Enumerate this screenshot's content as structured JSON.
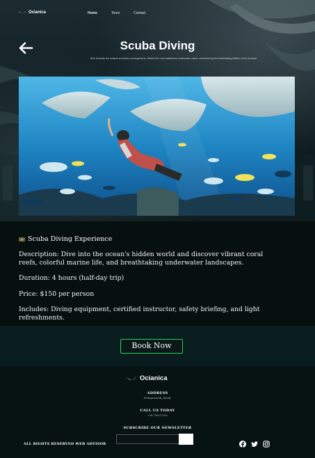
{
  "nav": {
    "brand": "Ocianica",
    "links": [
      "Home",
      "Tours",
      "Contact"
    ]
  },
  "hero": {
    "title": "Scuba Diving",
    "subtitle": "Dive beneath the surface to explore coral gardens, vibrant fish, and mysterious underwater caves, experiencing the breathtaking hidden world up close."
  },
  "details": {
    "heading": "Scuba Diving Experience",
    "description": "Description: Dive into the ocean's hidden world and discover vibrant coral reefs, colorful marine life, and breathtaking underwater landscapes.",
    "duration": "Duration: 4 hours (half-day trip)",
    "price": "Price: $150 per person",
    "includes": "Includes: Diving equipment, certified instructor, safety briefing, and light refreshments."
  },
  "cta": {
    "label": "Book Now"
  },
  "footer": {
    "brand": "Ocianica",
    "address_label": "ADDRESS",
    "address_value": "Bodugamavely, Bandy",
    "call_label": "CALL US TODAY",
    "call_value": "+94 756017385",
    "newsletter_label": "SUBSCRIBE OUR NEWSLETTER",
    "rights": "ALL RIGHTS RESERVED WEB ADVISOR"
  },
  "icons": {
    "brand": "wave-logo-icon",
    "back": "arrow-left-icon",
    "diver": "diver-emoji-icon",
    "socials": [
      "facebook-icon",
      "twitter-icon",
      "instagram-icon"
    ]
  },
  "colors": {
    "accent": "#27d15a",
    "background": "#071213"
  }
}
